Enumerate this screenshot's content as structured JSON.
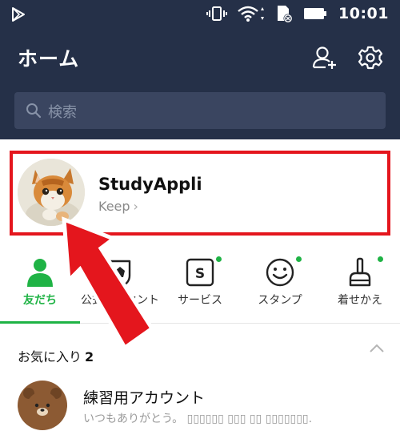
{
  "status_bar": {
    "time": "10:01",
    "icons": [
      "play-store-icon",
      "vibrate-icon",
      "wifi-icon",
      "sd-card-icon",
      "battery-icon"
    ]
  },
  "header": {
    "title": "ホーム",
    "icons": [
      "add-friend-icon",
      "settings-icon"
    ]
  },
  "search": {
    "placeholder": "検索"
  },
  "profile": {
    "name": "StudyAppli",
    "keep_label": "Keep",
    "keep_chevron": "›",
    "highlight_color": "#e4161d"
  },
  "tabs": [
    {
      "label": "友だち",
      "icon": "friends-icon",
      "active": true
    },
    {
      "label": "公式アカウント",
      "icon": "official-account-icon",
      "active": false
    },
    {
      "label": "サービス",
      "icon": "services-icon",
      "active": false,
      "new_dot": true
    },
    {
      "label": "スタンプ",
      "icon": "stickers-icon",
      "active": false,
      "new_dot": true
    },
    {
      "label": "着せかえ",
      "icon": "themes-icon",
      "active": false,
      "new_dot": true
    }
  ],
  "favorites": {
    "title": "お気に入り",
    "count": "2",
    "items": [
      {
        "name": "練習用アカウント",
        "status": "いつもありがとう。 ▯▯▯▯▯▯ ▯▯▯ ▯▯ ▯▯▯▯▯▯▯."
      }
    ]
  },
  "colors": {
    "header_bg": "#253048",
    "accent_green": "#1fb345",
    "annotation_red": "#e4161d"
  }
}
